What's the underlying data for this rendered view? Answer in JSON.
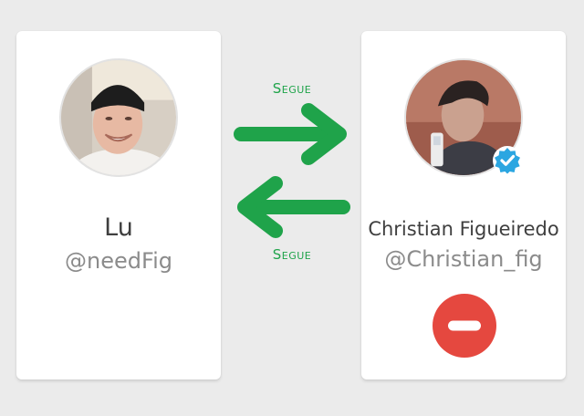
{
  "colors": {
    "background": "#ebebeb",
    "card": "#ffffff",
    "follow_green": "#1fa34a",
    "unfollow_red": "#e5483f",
    "verified_blue": "#2ba6e1",
    "name_text": "#3f3f3f",
    "handle_text": "#8b8b8b"
  },
  "left_user": {
    "display_name": "Lu",
    "handle": "@needFig"
  },
  "right_user": {
    "display_name": "Christian Figueiredo",
    "handle": "@Christian_fig",
    "verified": true
  },
  "relationship": {
    "top_label": "Segue",
    "bottom_label": "Segue",
    "top_arrow_icon": "arrow-right-icon",
    "bottom_arrow_icon": "arrow-left-icon"
  },
  "actions": {
    "unfollow_icon": "minus-circle-icon"
  }
}
